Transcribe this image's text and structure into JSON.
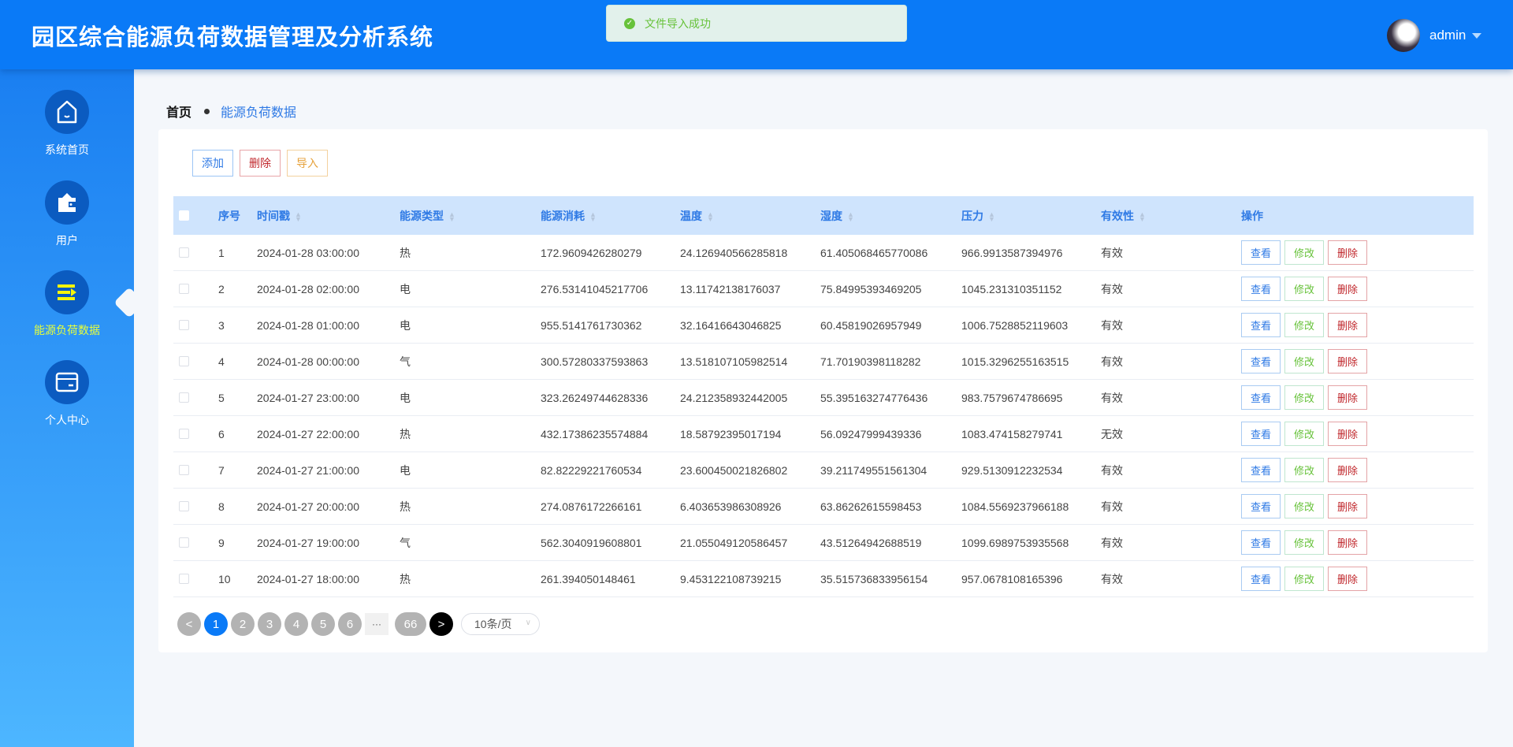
{
  "header": {
    "title": "园区综合能源负荷数据管理及分析系统",
    "username": "admin"
  },
  "toast": {
    "message": "文件导入成功"
  },
  "sidebar": {
    "items": [
      {
        "label": "系统首页"
      },
      {
        "label": "用户"
      },
      {
        "label": "能源负荷数据",
        "active": true
      },
      {
        "label": "个人中心"
      }
    ]
  },
  "breadcrumb": {
    "home": "首页",
    "current": "能源负荷数据"
  },
  "toolbar": {
    "add": "添加",
    "delete": "删除",
    "import": "导入"
  },
  "table": {
    "columns": [
      "序号",
      "时间戳",
      "能源类型",
      "能源消耗",
      "温度",
      "湿度",
      "压力",
      "有效性",
      "操作"
    ],
    "actions": {
      "view": "查看",
      "edit": "修改",
      "delete": "删除"
    },
    "rows": [
      [
        "1",
        "2024-01-28 03:00:00",
        "热",
        "172.9609426280279",
        "24.126940566285818",
        "61.405068465770086",
        "966.9913587394976",
        "有效"
      ],
      [
        "2",
        "2024-01-28 02:00:00",
        "电",
        "276.53141045217706",
        "13.11742138176037",
        "75.84995393469205",
        "1045.231310351152",
        "有效"
      ],
      [
        "3",
        "2024-01-28 01:00:00",
        "电",
        "955.5141761730362",
        "32.16416643046825",
        "60.45819026957949",
        "1006.7528852119603",
        "有效"
      ],
      [
        "4",
        "2024-01-28 00:00:00",
        "气",
        "300.57280337593863",
        "13.518107105982514",
        "71.70190398118282",
        "1015.3296255163515",
        "有效"
      ],
      [
        "5",
        "2024-01-27 23:00:00",
        "电",
        "323.26249744628336",
        "24.212358932442005",
        "55.395163274776436",
        "983.7579674786695",
        "有效"
      ],
      [
        "6",
        "2024-01-27 22:00:00",
        "热",
        "432.17386235574884",
        "18.58792395017194",
        "56.09247999439336",
        "1083.474158279741",
        "无效"
      ],
      [
        "7",
        "2024-01-27 21:00:00",
        "电",
        "82.82229221760534",
        "23.600450021826802",
        "39.211749551561304",
        "929.5130912232534",
        "有效"
      ],
      [
        "8",
        "2024-01-27 20:00:00",
        "热",
        "274.0876172266161",
        "6.403653986308926",
        "63.86262615598453",
        "1084.5569237966188",
        "有效"
      ],
      [
        "9",
        "2024-01-27 19:00:00",
        "气",
        "562.3040919608801",
        "21.055049120586457",
        "43.51264942688519",
        "1099.6989753935568",
        "有效"
      ],
      [
        "10",
        "2024-01-27 18:00:00",
        "热",
        "261.394050148461",
        "9.453122108739215",
        "35.515736833956154",
        "957.0678108165396",
        "有效"
      ]
    ]
  },
  "pagination": {
    "prev": "<",
    "pages": [
      "1",
      "2",
      "3",
      "4",
      "5",
      "6"
    ],
    "current": 1,
    "ellipsis": "···",
    "last": "66",
    "next": ">",
    "page_size": "10条/页"
  },
  "colors": {
    "primary": "#0a7af7",
    "active_nav": "#e6ff3a",
    "view": "#2f7ae5",
    "edit": "#67c23a",
    "delete": "#c0262b",
    "import": "#e6a23c"
  }
}
